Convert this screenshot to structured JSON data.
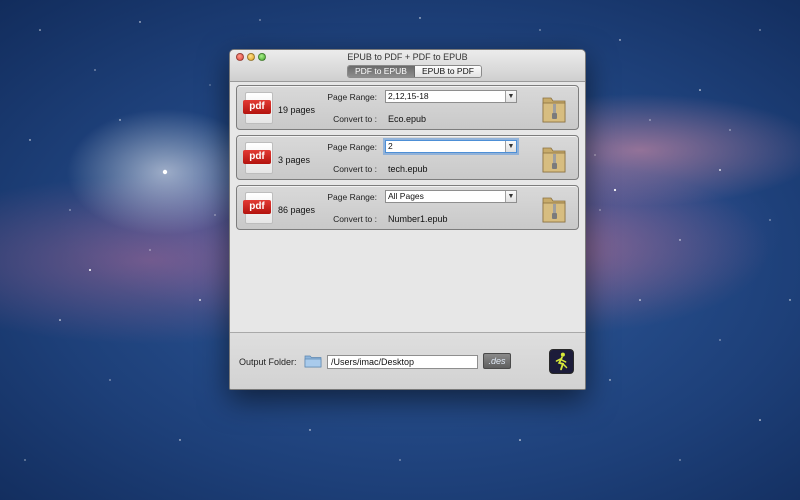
{
  "window": {
    "title": "EPUB to PDF + PDF to EPUB",
    "tabs": [
      {
        "label": "PDF to EPUB",
        "active": true
      },
      {
        "label": "EPUB to PDF",
        "active": false
      }
    ]
  },
  "labels": {
    "page_range": "Page Range:",
    "convert_to": "Convert to :"
  },
  "files": [
    {
      "icon": "pdf",
      "pages": "19 pages",
      "page_range": "2,12,15-18",
      "convert_to": "Eco.epub"
    },
    {
      "icon": "pdf",
      "pages": "3 pages",
      "page_range": "2",
      "convert_to": "tech.epub"
    },
    {
      "icon": "pdf",
      "pages": "86 pages",
      "page_range": "All Pages",
      "convert_to": "Number1.epub"
    }
  ],
  "output": {
    "label": "Output Folder:",
    "path": "/Users/imac/Desktop",
    "des_label": ".des"
  },
  "colors": {
    "pdf_badge": "#d22a24",
    "focus_ring": "#5a96dc"
  }
}
